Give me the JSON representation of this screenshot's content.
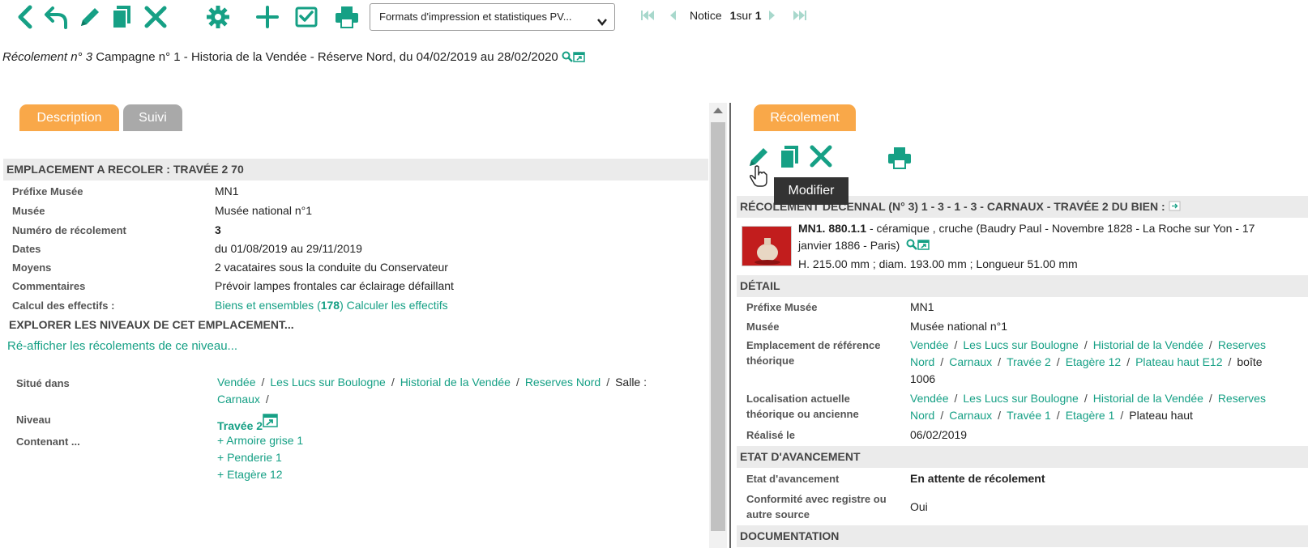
{
  "toolbar": {
    "icons": [
      "back-icon",
      "undo-icon",
      "pencil-icon",
      "copy-icon",
      "close-icon",
      "gear-icon",
      "plus-icon",
      "checkbox-icon",
      "print-icon"
    ],
    "format_select": "Formats d'impression et statistiques PV...",
    "pager": {
      "notice_label": "Notice",
      "current": "1",
      "sur": "sur",
      "total": "1"
    }
  },
  "breadcrumb": {
    "italic": "Récolement n° 3",
    "rest": "Campagne n° 1 - Historia de la Vendée - Réserve Nord, du 04/02/2019 au 28/02/2020"
  },
  "left": {
    "tabs": [
      {
        "label": "Description",
        "active": true
      },
      {
        "label": "Suivi",
        "active": false
      }
    ],
    "section_title": "EMPLACEMENT A RECOLER : TRAVÉE 2 70",
    "fields": [
      {
        "label": "Préfixe Musée",
        "value": "MN1"
      },
      {
        "label": "Musée",
        "value": "Musée national n°1"
      },
      {
        "label": "Numéro de récolement",
        "value": "3"
      },
      {
        "label": "Dates",
        "value": "du 01/08/2019 au 29/11/2019"
      },
      {
        "label": "Moyens",
        "value": "2 vacataires sous la conduite du Conservateur"
      },
      {
        "label": "Commentaires",
        "value": "Prévoir lampes frontales car éclairage défaillant"
      }
    ],
    "calcul": {
      "label": "Calcul des effectifs :",
      "link_prefix": "Biens et ensembles (",
      "count": "178",
      "link_suffix": ")",
      "link2": "Calculer les effectifs"
    },
    "explore_title": "EXPLORER LES NIVEAUX DE CET EMPLACEMENT...",
    "reafficher": "Ré-afficher les récolements de ce niveau...",
    "situe": {
      "label": "Situé dans",
      "path": [
        "Vendée",
        "Les Lucs sur Boulogne",
        "Historial de la Vendée",
        "Reserves Nord"
      ],
      "salle": "Salle :",
      "line2": "Carnaux"
    },
    "niveau": {
      "label": "Niveau",
      "value": "Travée 2"
    },
    "contenant": {
      "label": "Contenant ...",
      "items": [
        "+ Armoire grise 1",
        "+ Penderie 1",
        "+ Etagère 12"
      ]
    }
  },
  "right": {
    "tab": "Récolement",
    "tooltip": "Modifier",
    "section_title": "RÉCOLEMENT DECENNAL (N° 3) 1 - 3 - 1 - 3 - CARNAUX - TRAVÉE 2 DU BIEN :",
    "object": {
      "id": "MN1. 880.1.1",
      "desc1": " - céramique , cruche (Baudry Paul - Novembre 1828 - La Roche sur Yon - 17",
      "desc2": "janvier 1886 - Paris)",
      "dims": "H. 215.00 mm ; diam. 193.00 mm ; Longueur 51.00 mm"
    },
    "detail_title": "DÉTAIL",
    "detail": {
      "prefixe_label": "Préfixe Musée",
      "prefixe": "MN1",
      "musee_label": "Musée",
      "musee": "Musée national n°1",
      "empl_label1": "Emplacement de référence",
      "empl_label2": "théorique",
      "empl_line1": [
        "Vendée",
        "Les Lucs sur Boulogne",
        "Historial de la Vendée",
        "Reserves"
      ],
      "empl_line2": [
        "Nord",
        "Carnaux",
        "Travée 2",
        "Etagère 12",
        "Plateau haut E12"
      ],
      "empl_line2_tail": "boîte",
      "empl_line3": "1006",
      "loc_label1": "Localisation actuelle",
      "loc_label2": "théorique ou ancienne",
      "loc_line1": [
        "Vendée",
        "Les Lucs sur Boulogne",
        "Historial de la Vendée",
        "Reserves"
      ],
      "loc_line2": [
        "Nord",
        "Carnaux",
        "Travée 1",
        "Etagère 1"
      ],
      "loc_line2_tail": "Plateau haut",
      "realise_label": "Réalisé le",
      "realise": "06/02/2019"
    },
    "etat_title": "ETAT D'AVANCEMENT",
    "etat": {
      "label": "Etat d'avancement",
      "value": "En attente de récolement",
      "conf_label1": "Conformité avec registre ou",
      "conf_label2": "autre source",
      "conf_value": "Oui"
    },
    "doc_title": "DOCUMENTATION"
  },
  "colors": {
    "teal": "#16a085",
    "orange": "#f9a849",
    "grey_tab": "#a9a9a9",
    "section_bg": "#ebebeb"
  }
}
